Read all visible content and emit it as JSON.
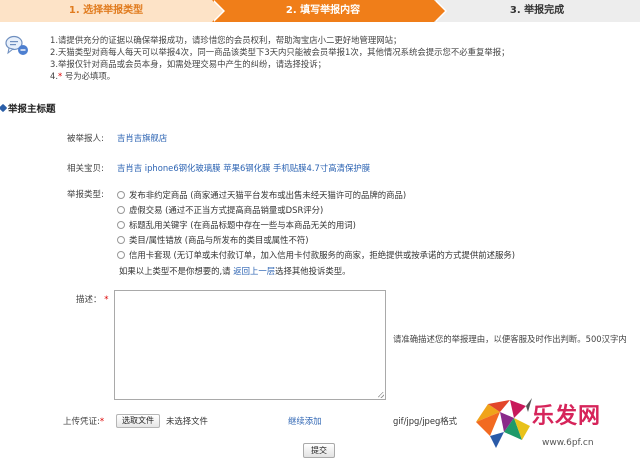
{
  "steps": [
    {
      "label": "1. 选择举报类型"
    },
    {
      "label": "2. 填写举报内容"
    },
    {
      "label": "3. 举报完成"
    }
  ],
  "notice": {
    "lines": [
      "1.请提供充分的证据以确保举报成功，请珍惜您的会员权利，帮助淘宝店小二更好地管理网站；",
      "2.天猫类型对商每人每天可以举报4次，同一商品该类型下3天内只能被会员举报1次，其他情况系统会提示您不必重复举报；",
      "3.举报仅针对商品或会员本身，如需处理交易中产生的纠纷，请选择投诉；",
      "4."
    ],
    "required_note": "号为必填项。"
  },
  "section_title": "举报主标题",
  "reported_user": {
    "label": "被举报人:",
    "value": "吉肖吉旗舰店"
  },
  "related_item": {
    "label": "相关宝贝:",
    "value": "吉肖吉 iphone6钢化玻璃膜 苹果6钢化膜 手机贴膜4.7寸高清保护膜"
  },
  "report_type": {
    "label": "举报类型:",
    "options": [
      "发布非约定商品 (商家通过天猫平台发布或出售未经天猫许可的品牌的商品)",
      "虚假交易 (通过不正当方式提高商品销量或DSR评分)",
      "标题乱用关键字 (在商品标题中存在一些与本商品无关的用词)",
      "类目/属性错放 (商品与所发布的类目或属性不符)",
      "信用卡套现 (无订单或未付款订单，加入信用卡付款服务的商家，拒绝提供或按承诺的方式提供前述服务)"
    ],
    "footer_prefix": "如果以上类型不是你想要的,请",
    "footer_link": "返回上一层",
    "footer_suffix": "选择其他投诉类型。"
  },
  "description": {
    "label": "描述：",
    "required_mark": "*",
    "hint": "请准确描述您的举报理由，以便客服及时作出判断。500汉字内"
  },
  "upload": {
    "label": "上传凭证:",
    "required_mark": "*",
    "button_label": "选取文件",
    "status": "未选择文件",
    "add_link": "继续添加",
    "format": "gif/jpg/jpeg格式"
  },
  "submit_label": "提交",
  "watermark": {
    "name": "乐发网",
    "url": "www.6pf.cn"
  },
  "colors": {
    "step_active": "#f07e19",
    "step_done": "#fde3c7",
    "link": "#2d64b3",
    "required": "#dd0000"
  }
}
